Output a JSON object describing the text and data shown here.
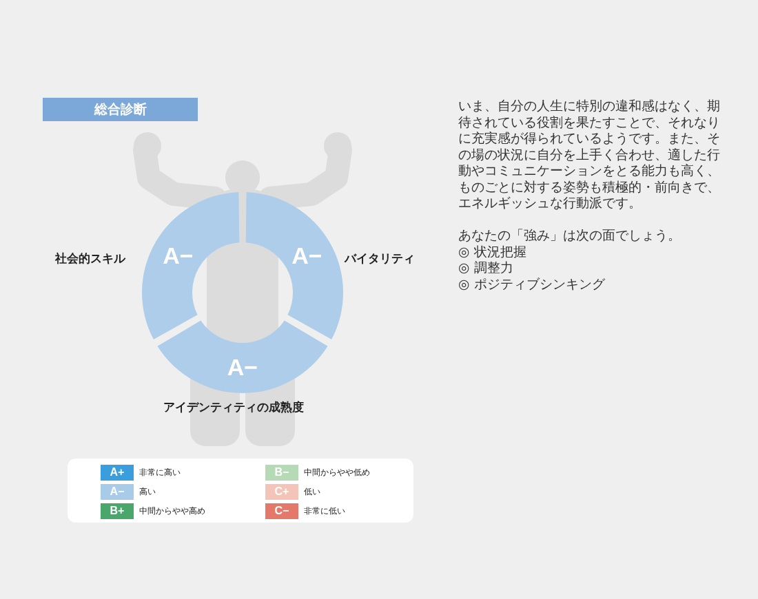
{
  "title": "総合診断",
  "segments": [
    {
      "kind": "left",
      "name": "社会的スキル",
      "grade": "A−",
      "color": "#aecdeb"
    },
    {
      "kind": "right",
      "name": "バイタリティ",
      "grade": "A−",
      "color": "#aecdeb"
    },
    {
      "kind": "bottom",
      "name": "アイデンティティの成熟度",
      "grade": "A−",
      "color": "#aecdeb"
    }
  ],
  "legend": [
    {
      "grade": "A+",
      "label": "非常に高い",
      "color": "#3a9ede"
    },
    {
      "grade": "A−",
      "label": "高い",
      "color": "#a9cbea"
    },
    {
      "grade": "B+",
      "label": "中間からやや高め",
      "color": "#4aa66a"
    },
    {
      "grade": "B−",
      "label": "中間からやや低め",
      "color": "#b5dab5"
    },
    {
      "grade": "C+",
      "label": "低い",
      "color": "#f4c4b8"
    },
    {
      "grade": "C−",
      "label": "非常に低い",
      "color": "#e4796b"
    }
  ],
  "description": "いま、自分の人生に特別の違和感はなく、期待されている役割を果たすことで、それなりに充実感が得られているようです。また、その場の状況に自分を上手く合わせ、適した行動やコミュニケーションをとる能力も高く、ものごとに対する姿勢も積極的・前向きで、エネルギッシュな行動派です。",
  "strengths_intro": "あなたの「強み」は次の面でしょう。",
  "strengths": [
    "◎ 状況把握",
    "◎ 調整力",
    "◎ ポジティブシンキング"
  ]
}
